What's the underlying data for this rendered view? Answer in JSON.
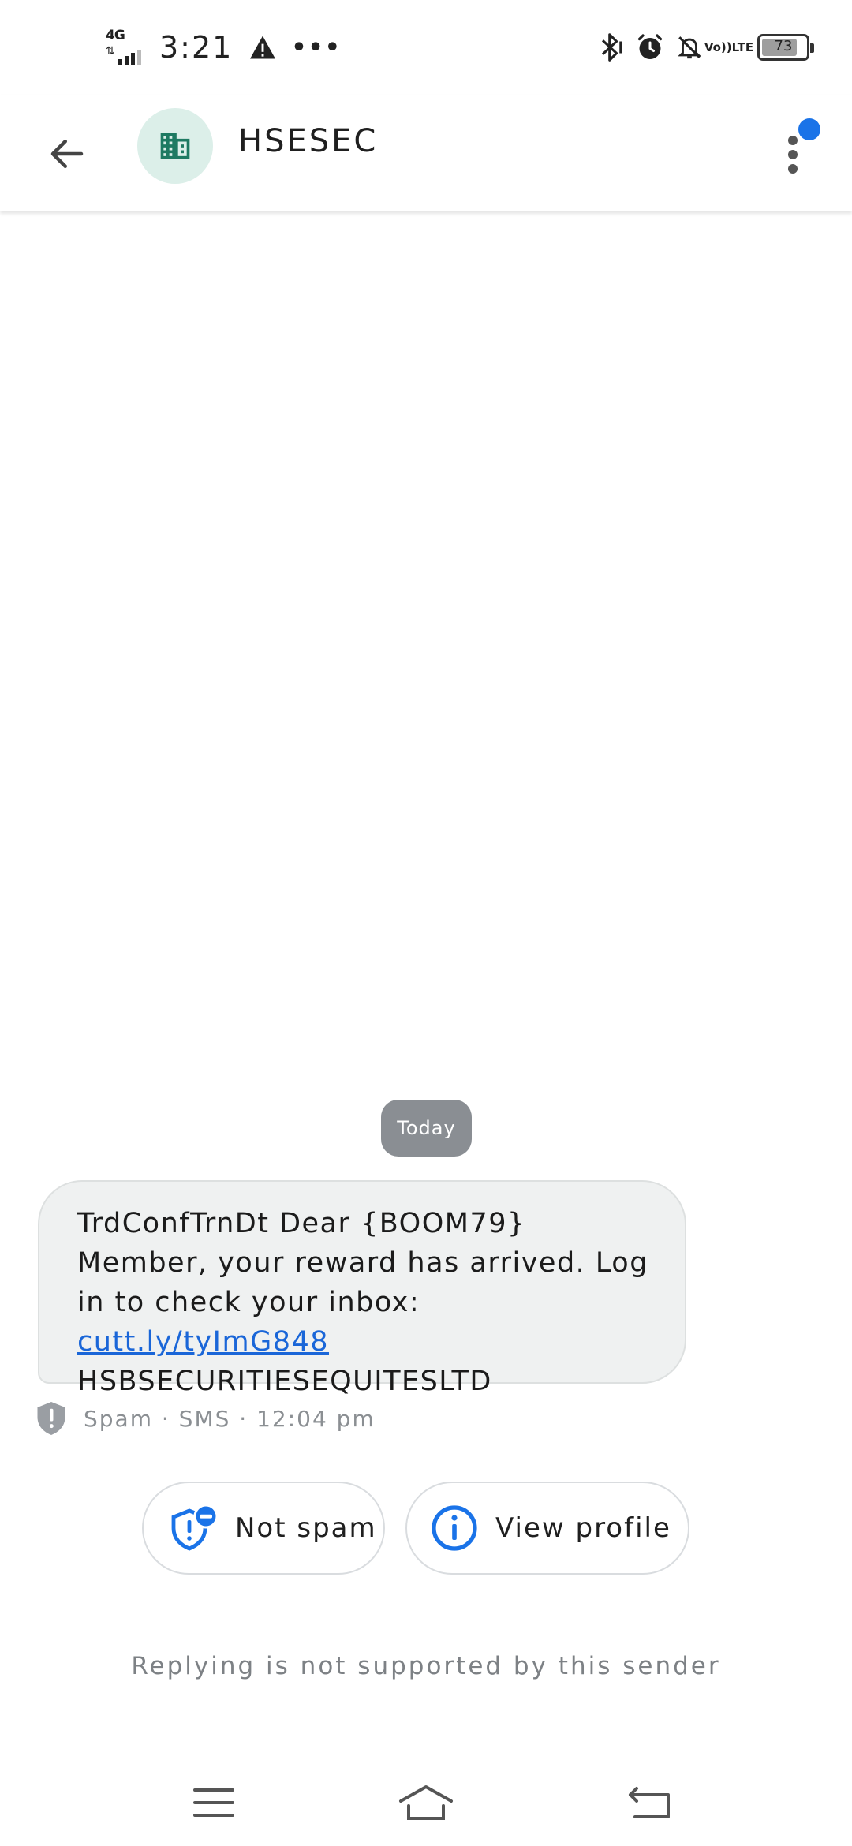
{
  "status_bar": {
    "network": "4G",
    "time": "3:21",
    "more_indicator": "•••",
    "battery": "73",
    "volte_top": "Vo))",
    "volte_bottom": "LTE",
    "icons": [
      "signal-icon",
      "warning-icon",
      "bluetooth-icon",
      "alarm-icon",
      "mute-icon",
      "volte-icon",
      "battery-icon"
    ]
  },
  "app_bar": {
    "sender_name": "HSESEC",
    "back_icon": "arrow-left-icon",
    "avatar_icon": "business-building-icon",
    "overflow_icon": "more-vert-icon",
    "accent_color": "#1a73e8"
  },
  "conversation": {
    "date_chip": "Today",
    "message": {
      "text_before_link": "TrdConfTrnDt Dear {BOOM79} Member, your reward has arrived. Log in to check your inbox: ",
      "link": "cutt.ly/tyImG848",
      "text_after_link": " HSBSECURITIESEQUITESLTD"
    },
    "meta": "Spam · SMS · 12:04 pm",
    "actions": {
      "not_spam": "Not spam",
      "view_profile": "View profile"
    },
    "reply_note": "Replying is not supported by this sender"
  },
  "nav_bar": {
    "icons": [
      "menu-icon",
      "home-icon",
      "back-icon"
    ]
  }
}
